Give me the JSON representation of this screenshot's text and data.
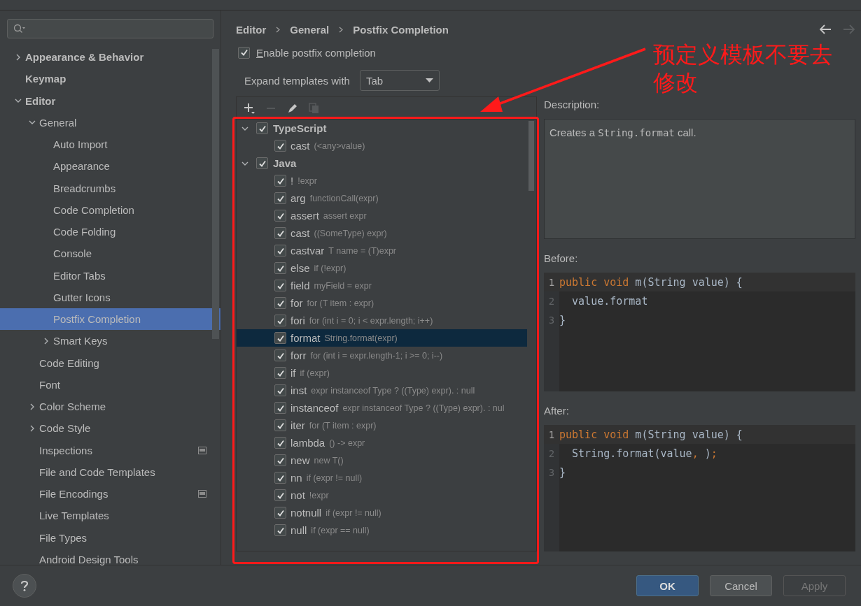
{
  "sidebar": {
    "search": {
      "kind": "search"
    },
    "items": [
      {
        "label": "Appearance & Behavior",
        "selected": false,
        "expanded": false
      },
      {
        "label": "Keymap",
        "selected": false
      },
      {
        "label": "Editor",
        "selected": false,
        "expanded": true,
        "children": [
          {
            "label": "General",
            "selected": false,
            "expanded": true,
            "children": [
              {
                "label": "Auto Import",
                "selected": false
              },
              {
                "label": "Appearance",
                "selected": false
              },
              {
                "label": "Breadcrumbs",
                "selected": false
              },
              {
                "label": "Code Completion",
                "selected": false
              },
              {
                "label": "Code Folding",
                "selected": false
              },
              {
                "label": "Console",
                "selected": false
              },
              {
                "label": "Editor Tabs",
                "selected": false
              },
              {
                "label": "Gutter Icons",
                "selected": false
              },
              {
                "label": "Postfix Completion",
                "selected": true
              },
              {
                "label": "Smart Keys",
                "selected": false,
                "expanded": false
              }
            ]
          },
          {
            "label": "Code Editing",
            "selected": false
          },
          {
            "label": "Font",
            "selected": false
          },
          {
            "label": "Color Scheme",
            "selected": false,
            "expanded": false
          },
          {
            "label": "Code Style",
            "selected": false,
            "expanded": false
          },
          {
            "label": "Inspections",
            "selected": false,
            "project_scoped": true
          },
          {
            "label": "File and Code Templates",
            "selected": false
          },
          {
            "label": "File Encodings",
            "selected": false,
            "project_scoped": true
          },
          {
            "label": "Live Templates",
            "selected": false
          },
          {
            "label": "File Types",
            "selected": false
          },
          {
            "label": "Android Design Tools",
            "selected": false
          }
        ]
      }
    ]
  },
  "breadcrumbs": [
    "Editor",
    "General",
    "Postfix Completion"
  ],
  "navigation": [
    {
      "kind": "back",
      "disabled": false
    },
    {
      "kind": "forward",
      "disabled": true
    }
  ],
  "enable_option": {
    "label": "Enable postfix completion",
    "checked": true
  },
  "expand_with": {
    "label": "Expand templates with",
    "value": "Tab"
  },
  "toolbar": [
    {
      "kind": "add",
      "disabled": false
    },
    {
      "kind": "remove",
      "disabled": true
    },
    {
      "kind": "edit",
      "disabled": false
    },
    {
      "kind": "copy",
      "disabled": true
    }
  ],
  "templates": [
    {
      "name": "TypeScript",
      "checked": true,
      "expanded": true,
      "children": [
        {
          "name": "cast",
          "example": "(<any>value)",
          "checked": true,
          "selected": false
        }
      ]
    },
    {
      "name": "Java",
      "checked": true,
      "expanded": true,
      "children": [
        {
          "name": "!",
          "example": "!expr",
          "checked": true,
          "selected": false
        },
        {
          "name": "arg",
          "example": "functionCall(expr)",
          "checked": true,
          "selected": false
        },
        {
          "name": "assert",
          "example": "assert expr",
          "checked": true,
          "selected": false
        },
        {
          "name": "cast",
          "example": "((SomeType) expr)",
          "checked": true,
          "selected": false
        },
        {
          "name": "castvar",
          "example": "T name = (T)expr",
          "checked": true,
          "selected": false
        },
        {
          "name": "else",
          "example": "if (!expr)",
          "checked": true,
          "selected": false
        },
        {
          "name": "field",
          "example": "myField = expr",
          "checked": true,
          "selected": false
        },
        {
          "name": "for",
          "example": "for (T item : expr)",
          "checked": true,
          "selected": false
        },
        {
          "name": "fori",
          "example": "for (int i = 0; i < expr.length; i++)",
          "checked": true,
          "selected": false
        },
        {
          "name": "format",
          "example": "String.format(expr)",
          "checked": true,
          "selected": true
        },
        {
          "name": "forr",
          "example": "for (int i = expr.length-1; i >= 0; i--)",
          "checked": true,
          "selected": false
        },
        {
          "name": "if",
          "example": "if (expr)",
          "checked": true,
          "selected": false
        },
        {
          "name": "inst",
          "example": "expr instanceof Type ? ((Type) expr). : null",
          "checked": true,
          "selected": false
        },
        {
          "name": "instanceof",
          "example": "expr instanceof Type ? ((Type) expr). : nul",
          "checked": true,
          "selected": false
        },
        {
          "name": "iter",
          "example": "for (T item : expr)",
          "checked": true,
          "selected": false
        },
        {
          "name": "lambda",
          "example": "() -> expr",
          "checked": true,
          "selected": false
        },
        {
          "name": "new",
          "example": "new T()",
          "checked": true,
          "selected": false
        },
        {
          "name": "nn",
          "example": "if (expr != null)",
          "checked": true,
          "selected": false
        },
        {
          "name": "not",
          "example": "!expr",
          "checked": true,
          "selected": false
        },
        {
          "name": "notnull",
          "example": "if (expr != null)",
          "checked": true,
          "selected": false
        },
        {
          "name": "null",
          "example": "if (expr == null)",
          "checked": true,
          "selected": false
        }
      ]
    }
  ],
  "description": {
    "label": "Description:",
    "parts": [
      {
        "kind": "text",
        "text": "Creates a "
      },
      {
        "kind": "code",
        "text": "String.format"
      },
      {
        "kind": "text",
        "text": " call."
      }
    ]
  },
  "before": {
    "label": "Before:",
    "lines": [
      {
        "number": "1",
        "current": true,
        "tokens": [
          {
            "kind": "keyword",
            "text": "public void"
          },
          {
            "kind": "plain",
            "text": " m(String value) {"
          }
        ]
      },
      {
        "number": "2",
        "current": false,
        "tokens": [
          {
            "kind": "plain",
            "text": "  value.format"
          }
        ]
      },
      {
        "number": "3",
        "current": false,
        "tokens": [
          {
            "kind": "plain",
            "text": "}"
          }
        ]
      }
    ]
  },
  "after": {
    "label": "After:",
    "lines": [
      {
        "number": "1",
        "current": true,
        "tokens": [
          {
            "kind": "keyword",
            "text": "public void"
          },
          {
            "kind": "plain",
            "text": " m(String value) {"
          }
        ]
      },
      {
        "number": "2",
        "current": false,
        "tokens": [
          {
            "kind": "plain",
            "text": "  String.format(value"
          },
          {
            "kind": "punct",
            "text": ", "
          },
          {
            "kind": "plain",
            "text": ")"
          },
          {
            "kind": "punct",
            "text": ";"
          }
        ]
      },
      {
        "number": "3",
        "current": false,
        "tokens": [
          {
            "kind": "plain",
            "text": "}"
          }
        ]
      }
    ]
  },
  "buttons": [
    {
      "label": "OK",
      "kind": "primary",
      "disabled": false
    },
    {
      "label": "Cancel",
      "kind": "normal",
      "disabled": false
    },
    {
      "label": "Apply",
      "kind": "normal",
      "disabled": true
    }
  ],
  "annotation": {
    "text": "预定义模板不要去修改"
  }
}
